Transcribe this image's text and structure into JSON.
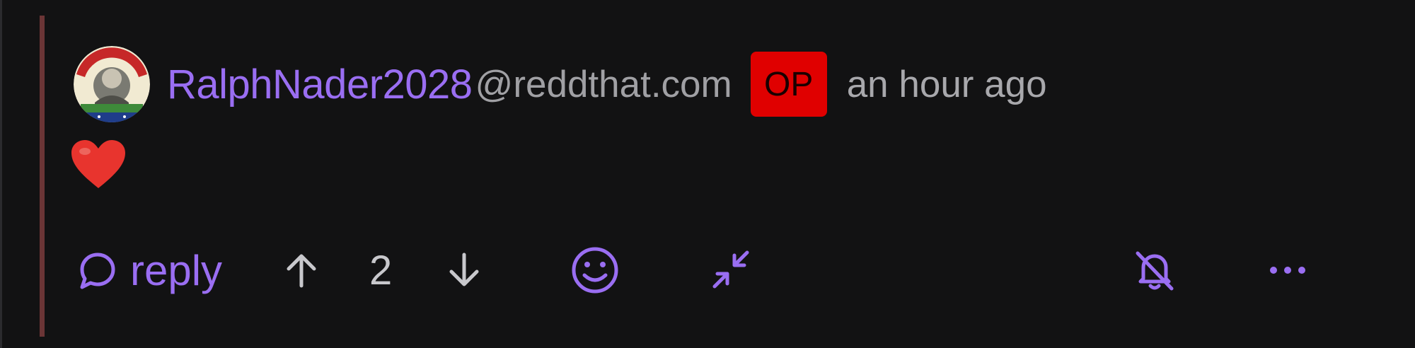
{
  "comment": {
    "author": {
      "username": "RalphNader2028",
      "instance": "@reddthat.com",
      "avatar_icon": "campaign-button-avatar"
    },
    "op_badge": "OP",
    "timestamp": "an hour ago",
    "body_icon": "red-heart-emoji"
  },
  "actions": {
    "reply_label": "reply",
    "reply_icon": "speech-bubble-icon",
    "upvote_icon": "arrow-up-icon",
    "score": "2",
    "downvote_icon": "arrow-down-icon",
    "emoji_icon": "smiley-icon",
    "collapse_icon": "collapse-arrows-icon",
    "notifications_icon": "bell-off-icon",
    "more_icon": "ellipsis-icon"
  },
  "colors": {
    "background": "#121213",
    "accent": "#9a6ef2",
    "thread_line": "#6b3536",
    "op_badge": "#e00000",
    "muted_text": "#a0a0a4"
  }
}
